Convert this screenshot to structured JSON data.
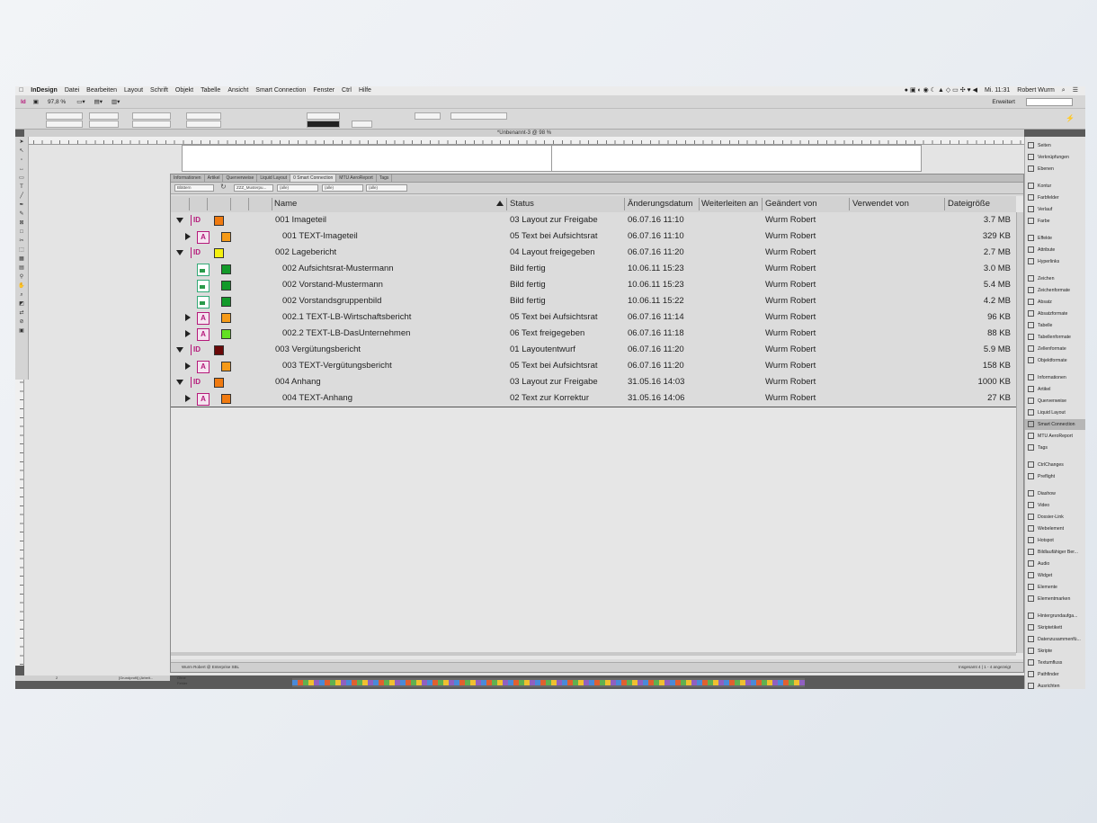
{
  "menubar": {
    "apple": "",
    "app": "InDesign",
    "items": [
      "Datei",
      "Bearbeiten",
      "Layout",
      "Schrift",
      "Objekt",
      "Tabelle",
      "Ansicht",
      "Smart Connection",
      "Fenster",
      "Ctrl",
      "Hilfe"
    ],
    "clock": "Mi. 11:31",
    "user": "Robert Wurm"
  },
  "appbar": {
    "logo": "Id",
    "zoom": "97,8 %",
    "workspace": "Erweitert"
  },
  "document": {
    "title": "*Unbenannt-3 @ 98 %"
  },
  "panel": {
    "tabs": [
      "Informationen",
      "Artikel",
      "Querverweise",
      "Liquid Layout",
      "0 Smart Connection",
      "MTU AeroReport",
      "Tags"
    ],
    "active_tab": "0 Smart Connection",
    "filters": [
      "Blättern",
      "ZZZ_Musterpu...",
      "(alle)",
      "(alle)",
      "(alle)"
    ],
    "columns": [
      "Name",
      "Status",
      "Änderungsdatum",
      "Weiterleiten an",
      "Geändert von",
      "Verwendet von",
      "Dateigröße"
    ],
    "rows": [
      {
        "level": 0,
        "type": "layout",
        "expand": "open",
        "color": "#f07a10",
        "name": "001 Imageteil",
        "status": "03 Layout zur Freigabe",
        "date": "06.07.16 11:10",
        "route": "",
        "modified_by": "Wurm Robert",
        "used_by": "",
        "size": "3.7 MB"
      },
      {
        "level": 1,
        "type": "article",
        "expand": "closed",
        "color": "#f59a18",
        "name": "001 TEXT-Imageteil",
        "status": "05 Text bei Aufsichtsrat",
        "date": "06.07.16 11:10",
        "route": "",
        "modified_by": "Wurm Robert",
        "used_by": "",
        "size": "329 KB"
      },
      {
        "level": 0,
        "type": "layout",
        "expand": "open",
        "color": "#f4f010",
        "name": "002 Lagebericht",
        "status": "04 Layout freigegeben",
        "date": "06.07.16 11:20",
        "route": "",
        "modified_by": "Wurm Robert",
        "used_by": "",
        "size": "2.7 MB"
      },
      {
        "level": 1,
        "type": "image",
        "expand": "none",
        "color": "#129a2a",
        "name": "002 Aufsichtsrat-Mustermann",
        "status": "Bild fertig",
        "date": "10.06.11 15:23",
        "route": "",
        "modified_by": "Wurm Robert",
        "used_by": "",
        "size": "3.0 MB"
      },
      {
        "level": 1,
        "type": "image",
        "expand": "none",
        "color": "#129a2a",
        "name": "002 Vorstand-Mustermann",
        "status": "Bild fertig",
        "date": "10.06.11 15:23",
        "route": "",
        "modified_by": "Wurm Robert",
        "used_by": "",
        "size": "5.4 MB"
      },
      {
        "level": 1,
        "type": "image",
        "expand": "none",
        "color": "#129a2a",
        "name": "002 Vorstandsgruppenbild",
        "status": "Bild fertig",
        "date": "10.06.11 15:22",
        "route": "",
        "modified_by": "Wurm Robert",
        "used_by": "",
        "size": "4.2 MB"
      },
      {
        "level": 1,
        "type": "article",
        "expand": "closed",
        "color": "#f59a18",
        "name": "002.1 TEXT-LB-Wirtschaftsbericht",
        "status": "05 Text bei Aufsichtsrat",
        "date": "06.07.16 11:14",
        "route": "",
        "modified_by": "Wurm Robert",
        "used_by": "",
        "size": "96 KB"
      },
      {
        "level": 1,
        "type": "article",
        "expand": "closed",
        "color": "#62e022",
        "name": "002.2 TEXT-LB-DasUnternehmen",
        "status": "06 Text freigegeben",
        "date": "06.07.16 11:18",
        "route": "",
        "modified_by": "Wurm Robert",
        "used_by": "",
        "size": "88 KB"
      },
      {
        "level": 0,
        "type": "layout",
        "expand": "open",
        "color": "#6a0808",
        "name": "003 Vergütungsbericht",
        "status": "01 Layoutentwurf",
        "date": "06.07.16 11:20",
        "route": "",
        "modified_by": "Wurm Robert",
        "used_by": "",
        "size": "5.9 MB"
      },
      {
        "level": 1,
        "type": "article",
        "expand": "closed",
        "color": "#f59a18",
        "name": "003 TEXT-Vergütungsbericht",
        "status": "05 Text bei Aufsichtsrat",
        "date": "06.07.16 11:20",
        "route": "",
        "modified_by": "Wurm Robert",
        "used_by": "",
        "size": "158 KB"
      },
      {
        "level": 0,
        "type": "layout",
        "expand": "open",
        "color": "#f07a10",
        "name": "004 Anhang",
        "status": "03 Layout zur Freigabe",
        "date": "31.05.16 14:03",
        "route": "",
        "modified_by": "Wurm Robert",
        "used_by": "",
        "size": "1000 KB"
      },
      {
        "level": 1,
        "type": "article",
        "expand": "closed",
        "color": "#f07a10",
        "name": "004 TEXT-Anhang",
        "status": "02 Text zur Korrektur",
        "date": "31.05.16 14:06",
        "route": "",
        "modified_by": "Wurm Robert",
        "used_by": "",
        "size": "27 KB"
      }
    ],
    "status_left": "Wurm Robert @ Enterprise SBL",
    "status_right": "Insgesamt 4 | 1 - 4 angezeigt"
  },
  "right_panels": [
    {
      "label": "Seiten",
      "icon": "pages-icon"
    },
    {
      "label": "Verknüpfungen",
      "icon": "links-icon"
    },
    {
      "label": "Ebenen",
      "icon": "layers-icon"
    },
    {
      "label": "Kontur",
      "icon": "stroke-icon"
    },
    {
      "label": "Farbfelder",
      "icon": "swatches-icon"
    },
    {
      "label": "Verlauf",
      "icon": "gradient-icon"
    },
    {
      "label": "Farbe",
      "icon": "color-icon"
    },
    {
      "label": "Effekte",
      "icon": "effects-icon"
    },
    {
      "label": "Attribute",
      "icon": "attributes-icon"
    },
    {
      "label": "Hyperlinks",
      "icon": "hyperlinks-icon"
    },
    {
      "label": "Zeichen",
      "icon": "character-icon"
    },
    {
      "label": "Zeichenformate",
      "icon": "character-styles-icon"
    },
    {
      "label": "Absatz",
      "icon": "paragraph-icon"
    },
    {
      "label": "Absatzformate",
      "icon": "paragraph-styles-icon"
    },
    {
      "label": "Tabelle",
      "icon": "table-icon"
    },
    {
      "label": "Tabellenformate",
      "icon": "table-styles-icon"
    },
    {
      "label": "Zellenformate",
      "icon": "cell-styles-icon"
    },
    {
      "label": "Objektformate",
      "icon": "object-styles-icon"
    },
    {
      "label": "Informationen",
      "icon": "info-icon"
    },
    {
      "label": "Artikel",
      "icon": "articles-icon"
    },
    {
      "label": "Querverweise",
      "icon": "crossref-icon"
    },
    {
      "label": "Liquid Layout",
      "icon": "liquid-layout-icon"
    },
    {
      "label": "Smart Connection",
      "icon": "smart-connection-icon"
    },
    {
      "label": "MTU AeroReport",
      "icon": "aeroreport-icon"
    },
    {
      "label": "Tags",
      "icon": "tags-icon"
    },
    {
      "label": "CtrlChanges",
      "icon": "ctrlchanges-icon"
    },
    {
      "label": "Preflight",
      "icon": "preflight-icon"
    },
    {
      "label": "Diashow",
      "icon": "slideshow-icon"
    },
    {
      "label": "Video",
      "icon": "video-icon"
    },
    {
      "label": "Dossier-Link",
      "icon": "dossier-link-icon"
    },
    {
      "label": "Webelement",
      "icon": "webelement-icon"
    },
    {
      "label": "Hotspot",
      "icon": "hotspot-icon"
    },
    {
      "label": "Bildlaufähiger Ber...",
      "icon": "scroll-frame-icon"
    },
    {
      "label": "Audio",
      "icon": "audio-icon"
    },
    {
      "label": "Widget",
      "icon": "widget-icon"
    },
    {
      "label": "Elemente",
      "icon": "elements-icon"
    },
    {
      "label": "Elementmarken",
      "icon": "element-marks-icon"
    },
    {
      "label": "Hintergrundaufga...",
      "icon": "background-tasks-icon"
    },
    {
      "label": "Skriptetikett",
      "icon": "script-label-icon"
    },
    {
      "label": "Datenzusammenfü...",
      "icon": "data-merge-icon"
    },
    {
      "label": "Skripte",
      "icon": "scripts-icon"
    },
    {
      "label": "Textumfluss",
      "icon": "text-wrap-icon"
    },
    {
      "label": "Pathfinder",
      "icon": "pathfinder-icon"
    },
    {
      "label": "Ausrichten",
      "icon": "align-icon"
    }
  ],
  "selected_right_panel": "Smart Connection",
  "doc_status": {
    "page": "2",
    "profile": "[Grundprofil] (Arbeit...",
    "errors": "Ohne Fehler"
  }
}
